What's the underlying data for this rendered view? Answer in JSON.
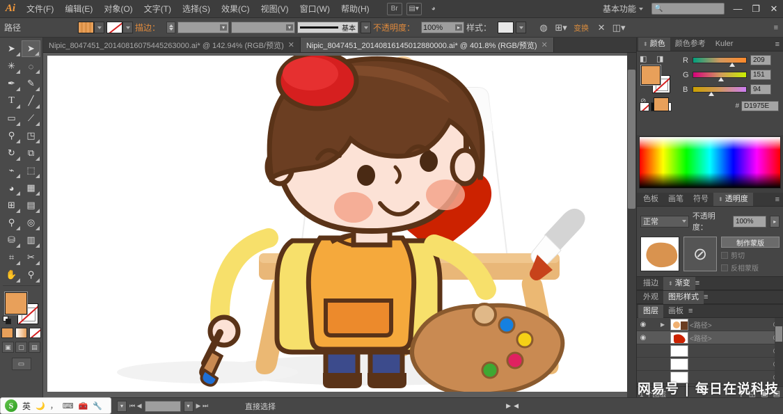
{
  "app": {
    "logo": "Ai",
    "menus": [
      {
        "label": "文件(F)"
      },
      {
        "label": "编辑(E)"
      },
      {
        "label": "对象(O)"
      },
      {
        "label": "文字(T)"
      },
      {
        "label": "选择(S)"
      },
      {
        "label": "效果(C)"
      },
      {
        "label": "视图(V)"
      },
      {
        "label": "窗口(W)"
      },
      {
        "label": "帮助(H)"
      }
    ],
    "bridge_icon": "br-icon",
    "arrange_icon": "arrange-documents-icon",
    "workspace": "基本功能",
    "search_placeholder": "",
    "search_value": "",
    "window_controls": {
      "minimize": "—",
      "restore": "❐",
      "close": "✕"
    }
  },
  "control_bar": {
    "selection_type": "路径",
    "fill_label": "fill-swatch",
    "stroke_label": "描边：",
    "stroke_weight_value": "",
    "stroke_profile_value": "",
    "brush_label": "基本",
    "opacity_label": "不透明度：",
    "opacity_value": "100%",
    "style_label": "样式：",
    "recolor_icon": "recolor-artwork-icon",
    "align_icon": "align-icon",
    "transform_label": "变换",
    "isolate_icon": "isolate-icon",
    "shape_icon": "shape-mode-icon",
    "panel_menu": "≡"
  },
  "tabs": [
    {
      "title": "Nipic_8047451_20140816075445263000.ai* @ 142.94% (RGB/预览)",
      "active": false,
      "close": "✕"
    },
    {
      "title": "Nipic_8047451_20140816145012880000.ai* @ 401.8% (RGB/预览)",
      "active": true,
      "close": "✕"
    }
  ],
  "toolbar": {
    "tools": [
      {
        "name": "selection-tool",
        "glyph": "➤",
        "active": false
      },
      {
        "name": "direct-selection-tool",
        "glyph": "➤",
        "active": true
      },
      {
        "name": "magic-wand-tool",
        "glyph": "✳",
        "active": false
      },
      {
        "name": "lasso-tool",
        "glyph": "◌",
        "active": false
      },
      {
        "name": "pen-tool",
        "glyph": "✒",
        "active": false
      },
      {
        "name": "add-anchor-point-tool",
        "glyph": "✎",
        "active": false
      },
      {
        "name": "type-tool",
        "glyph": "T",
        "active": false
      },
      {
        "name": "line-segment-tool",
        "glyph": "╱",
        "active": false
      },
      {
        "name": "rectangle-tool",
        "glyph": "▭",
        "active": false
      },
      {
        "name": "paintbrush-tool",
        "glyph": "🖌",
        "active": false
      },
      {
        "name": "blob-brush-tool",
        "glyph": "✐",
        "active": false
      },
      {
        "name": "eraser-tool",
        "glyph": "◳",
        "active": false
      },
      {
        "name": "rotate-tool",
        "glyph": "↻",
        "active": false
      },
      {
        "name": "scale-tool",
        "glyph": "⧉",
        "active": false
      },
      {
        "name": "width-tool",
        "glyph": "⌁",
        "active": false
      },
      {
        "name": "free-transform-tool",
        "glyph": "⬚",
        "active": false
      },
      {
        "name": "shape-builder-tool",
        "glyph": "◕",
        "active": false
      },
      {
        "name": "perspective-grid-tool",
        "glyph": "▦",
        "active": false
      },
      {
        "name": "mesh-tool",
        "glyph": "⊞",
        "active": false
      },
      {
        "name": "gradient-tool",
        "glyph": "▤",
        "active": false
      },
      {
        "name": "eyedropper-tool",
        "glyph": "⚲",
        "active": false
      },
      {
        "name": "blend-tool",
        "glyph": "◎",
        "active": false
      },
      {
        "name": "symbol-sprayer-tool",
        "glyph": "⛁",
        "active": false
      },
      {
        "name": "column-graph-tool",
        "glyph": "▥",
        "active": false
      },
      {
        "name": "artboard-tool",
        "glyph": "⌗",
        "active": false
      },
      {
        "name": "slice-tool",
        "glyph": "✂",
        "active": false
      },
      {
        "name": "hand-tool",
        "glyph": "✋",
        "active": false
      },
      {
        "name": "zoom-tool",
        "glyph": "⚲",
        "active": false
      }
    ],
    "fill_color": "#E8A05A",
    "stroke_color": "none",
    "color_mode_buttons": [
      "color-button",
      "gradient-button",
      "none-button"
    ],
    "draw_modes": [
      "draw-normal",
      "draw-behind",
      "draw-inside"
    ],
    "screen_mode": "change-screen-mode"
  },
  "color_panel": {
    "tabs": [
      {
        "label": "颜色",
        "active": true
      },
      {
        "label": "颜色参考",
        "active": false
      },
      {
        "label": "Kuler",
        "active": false
      }
    ],
    "menu": "≡",
    "channels": [
      {
        "label": "R",
        "value": "209",
        "pos": 68
      },
      {
        "label": "G",
        "value": "151",
        "pos": 48
      },
      {
        "label": "B",
        "value": "94",
        "pos": 30
      }
    ],
    "hex_prefix": "#",
    "hex_value": "D1975E",
    "fill_color": "#D1975E"
  },
  "transparency_panel": {
    "tabs": [
      {
        "label": "色板",
        "active": false
      },
      {
        "label": "画笔",
        "active": false
      },
      {
        "label": "符号",
        "active": false
      },
      {
        "label": "透明度",
        "active": true
      }
    ],
    "menu": "≡",
    "blend_mode": "正常",
    "opacity_label": "不透明度：",
    "opacity_value": "100%",
    "make_mask_button": "制作蒙版",
    "clip_checkbox": "剪切",
    "invert_mask_checkbox": "反相蒙版",
    "no_mask_icon": "no-mask-icon"
  },
  "stroke_gradient_bar": {
    "tabs": [
      {
        "label": "描边",
        "active": false
      },
      {
        "label": "渐变",
        "active": true
      }
    ],
    "menu": "≡"
  },
  "appearance_bar": {
    "tabs": [
      {
        "label": "外观",
        "active": false
      },
      {
        "label": "图形样式",
        "active": true
      }
    ],
    "menu": "≡"
  },
  "layers_panel": {
    "tabs": [
      {
        "label": "图层",
        "active": true
      },
      {
        "label": "画板",
        "active": false
      }
    ],
    "menu": "≡",
    "rows": [
      {
        "name": "<路径>",
        "eye": "◉",
        "expanded": true,
        "target": "◎",
        "selected": false
      },
      {
        "name": "<路径>",
        "eye": "◉",
        "expanded": false,
        "target": "◎",
        "selected": true
      },
      {
        "name": "",
        "eye": "",
        "expanded": false,
        "target": "◎",
        "selected": false
      },
      {
        "name": "",
        "eye": "",
        "expanded": false,
        "target": "◎",
        "selected": false
      },
      {
        "name": "",
        "eye": "",
        "expanded": false,
        "target": "◎",
        "selected": false
      }
    ],
    "footer_count": "1 个图层",
    "footer_icons": [
      "locate-object-icon",
      "make-sublayer-icon",
      "new-layer-icon",
      "delete-layer-icon"
    ]
  },
  "status_bar": {
    "zoom_value": "",
    "status_text": "直接选择",
    "nav_prev": "◀",
    "nav_next": "▶"
  },
  "ime": {
    "logo": "S",
    "mode": "英",
    "icons": [
      "moon-icon",
      "comma-icon",
      "keyboard-icon",
      "toolbox-icon",
      "wrench-icon"
    ]
  },
  "watermark": "网易号 | 每日在说科技",
  "artwork": {
    "description": "cartoon boy painting at an easel",
    "colors": {
      "hair": "#6B3E22",
      "hat": "#D61F1F",
      "skin": "#FCE2D6",
      "cheek": "#F3A58C",
      "shirt": "#F7E06B",
      "apron": "#F5A93C",
      "pants": "#3C4B8C",
      "easel": "#E8B878",
      "canvas": "#FFFFFF",
      "heart": "#CC2200",
      "palette": "#C98A52",
      "outline": "#5A3318"
    },
    "palette_dots": [
      "#1580E0",
      "#F5D016",
      "#E02060",
      "#3EA832"
    ]
  }
}
